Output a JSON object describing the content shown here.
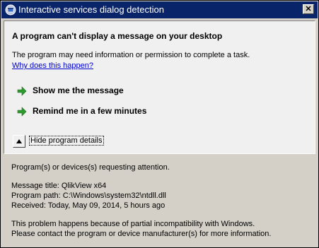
{
  "window": {
    "title": "Interactive services dialog detection"
  },
  "main": {
    "heading": "A program can't display a message on your desktop",
    "description": "The program may need information or permission to complete a task.",
    "why_link": "Why does this happen?",
    "actions": [
      {
        "label": "Show me the message"
      },
      {
        "label": "Remind me in a few minutes"
      }
    ],
    "toggle_label": "Hide program details"
  },
  "details": {
    "requesting": "Program(s) or devices(s) requesting attention.",
    "message_title": "Message title:  QlikView x64",
    "program_path": "Program path:  C:\\Windows\\system32\\ntdll.dll",
    "received": "Received:  Today, May 09, 2014, 5 hours ago",
    "explanation_1": "This problem happens because of partial incompatibility with Windows.",
    "explanation_2": "Please contact the program or device manufacturer(s) for more information."
  },
  "icons": {
    "title": "dialog-window-icon",
    "close": "close-icon",
    "action": "green-arrow-icon",
    "toggle": "triangle-up-icon"
  },
  "colors": {
    "titlebar": "#0a246a",
    "content_bg": "#f0f0f0",
    "window_bg": "#d4d0c8",
    "link": "#0000cc",
    "arrow": "#2e9b2e"
  }
}
